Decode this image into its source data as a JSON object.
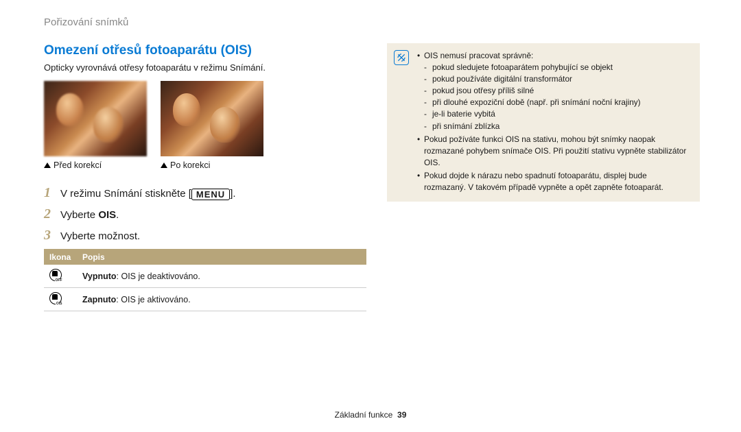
{
  "breadcrumb": "Pořizování snímků",
  "section_title": "Omezení otřesů fotoaparátu (OIS)",
  "intro": "Opticky vyrovnává otřesy fotoaparátu v režimu Snímání.",
  "captions": {
    "before": "Před korekcí",
    "after": "Po korekci"
  },
  "steps": {
    "s1_pre": "V režimu Snímání stiskněte [",
    "s1_mid": "MENU",
    "s1_post": "].",
    "s2_pre": "Vyberte ",
    "s2_bold": "OIS",
    "s2_post": ".",
    "s3": "Vyberte možnost."
  },
  "table": {
    "headers": {
      "icon": "Ikona",
      "desc": "Popis"
    },
    "rows": [
      {
        "icon_sub": "OFF",
        "label": "Vypnuto",
        "text": ": OIS je deaktivováno."
      },
      {
        "icon_sub": "OIS",
        "label": "Zapnuto",
        "text": ": OIS je aktivováno."
      }
    ]
  },
  "note": {
    "l0": "OIS nemusí pracovat správně:",
    "sub": [
      "pokud sledujete fotoaparátem pohybující se objekt",
      "pokud používáte digitální transformátor",
      "pokud jsou otřesy příliš silné",
      "při dlouhé expoziční době (např. při snímání noční krajiny)",
      "je-li baterie vybitá",
      "při snímání zblízka"
    ],
    "l1": "Pokud požíváte funkci OIS na stativu, mohou být snímky naopak rozmazané pohybem snímače OIS. Při použití stativu vypněte stabilizátor OIS.",
    "l2": "Pokud dojde k nárazu nebo spadnutí fotoaparátu, displej bude rozmazaný. V takovém případě vypněte a opět zapněte fotoaparát."
  },
  "footer": {
    "label": "Základní funkce",
    "page": "39"
  }
}
